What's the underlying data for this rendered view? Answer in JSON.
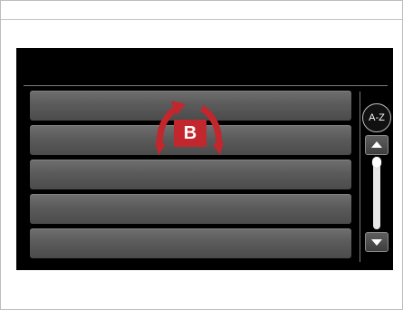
{
  "list": {
    "items": [
      {
        "label": ""
      },
      {
        "label": ""
      },
      {
        "label": ""
      },
      {
        "label": ""
      },
      {
        "label": ""
      }
    ]
  },
  "sidebar": {
    "az_label": "A-Z",
    "up_icon": "triangle-up-icon",
    "down_icon": "triangle-down-icon",
    "scroll_position": 0.0
  },
  "callout": {
    "label": "B",
    "icon": "rotate-gesture-icon",
    "color": "#c1272d"
  }
}
